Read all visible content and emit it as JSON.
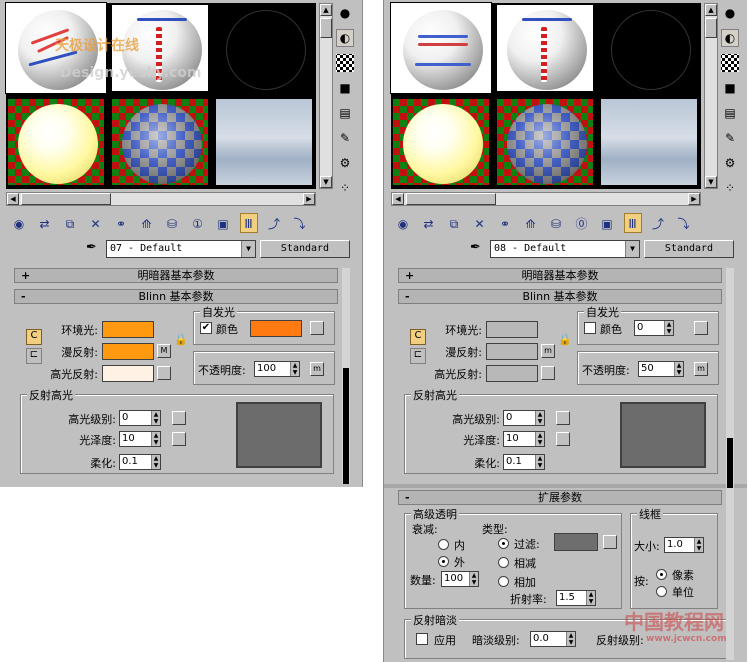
{
  "left_panel": {
    "material_name": "07 - Default",
    "material_type": "Standard",
    "rollouts": {
      "shader_basic": "明暗器基本参数",
      "blinn_basic": "Blinn 基本参数"
    },
    "blinn": {
      "ambient_label": "环境光:",
      "diffuse_label": "漫反射:",
      "specular_label": "高光反射:",
      "self_illum_title": "自发光",
      "color_label": "颜色",
      "color_checked": "✔",
      "opacity_label": "不透明度:",
      "opacity_value": "100",
      "m_label": "m",
      "map_label": "M",
      "spec_highlight_title": "反射高光",
      "spec_level_label": "高光级别:",
      "spec_level_value": "0",
      "gloss_label": "光泽度:",
      "gloss_value": "10",
      "soften_label": "柔化:",
      "soften_value": "0.1",
      "ambient_color": "#ff9910",
      "diffuse_color": "#ff9910",
      "specular_color": "#fff2e4",
      "self_illum_color": "#ff7a10"
    },
    "watermark_line1": "天极设计在线",
    "watermark_line2": "Design.yesky.com"
  },
  "right_panel": {
    "material_name": "08 - Default",
    "material_type": "Standard",
    "rollouts": {
      "shader_basic": "明暗器基本参数",
      "blinn_basic": "Blinn 基本参数",
      "extended": "扩展参数"
    },
    "blinn": {
      "ambient_label": "环境光:",
      "diffuse_label": "漫反射:",
      "specular_label": "高光反射:",
      "self_illum_title": "自发光",
      "color_label": "颜色",
      "color_value": "0",
      "opacity_label": "不透明度:",
      "opacity_value": "50",
      "m_label": "m",
      "spec_highlight_title": "反射高光",
      "spec_level_label": "高光级别:",
      "spec_level_value": "0",
      "gloss_label": "光泽度:",
      "gloss_value": "10",
      "soften_label": "柔化:",
      "soften_value": "0.1"
    },
    "extended": {
      "adv_transparency_title": "高级透明",
      "falloff_label": "衰减:",
      "in_label": "内",
      "out_label": "外",
      "amount_label": "数量:",
      "amount_value": "100",
      "type_label": "类型:",
      "filter_label": "过滤:",
      "subtractive_label": "相减",
      "additive_label": "相加",
      "ior_label": "折射率:",
      "ior_value": "1.5",
      "wire_title": "线框",
      "size_label": "大小:",
      "size_value": "1.0",
      "by_label": "按:",
      "pixels_label": "像素",
      "units_label": "单位",
      "refl_dim_title": "反射暗淡",
      "apply_label": "应用",
      "dim_level_label": "暗淡级别:",
      "dim_level_value": "0.0",
      "refl_level_label": "反射级别:"
    },
    "watermark_line1": "中国教程网",
    "watermark_line2": "www.jcwcn.com"
  }
}
